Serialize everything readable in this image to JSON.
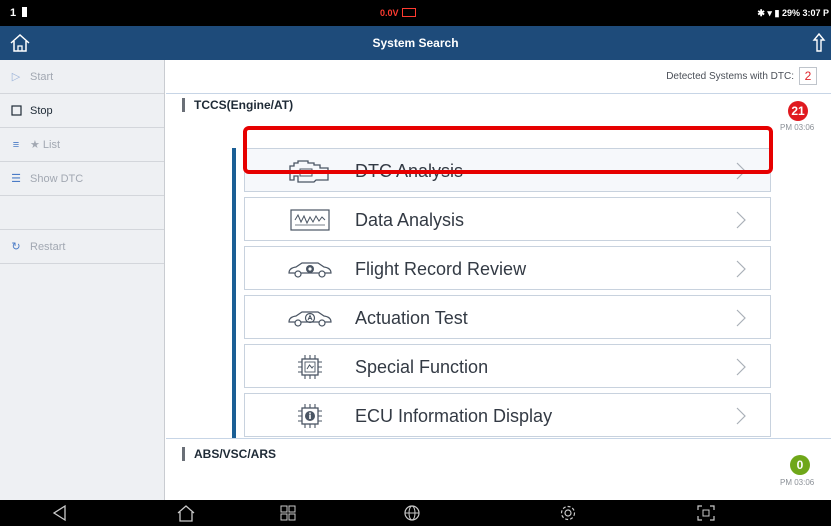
{
  "status_bar": {
    "left": "1",
    "voltage": "0.0V",
    "battery_pct": "29%",
    "clock": "3:07 P"
  },
  "title_bar": {
    "title": "System Search"
  },
  "sidebar": {
    "items": [
      {
        "label": "Start",
        "icon": "play-icon",
        "enabled": false
      },
      {
        "label": "Stop",
        "icon": "stop-square-icon",
        "enabled": true
      },
      {
        "label": "★ List",
        "icon": "list-icon",
        "enabled": false
      },
      {
        "label": "Show DTC",
        "icon": "dtc-list-icon",
        "enabled": false
      },
      {
        "label": "",
        "icon": "",
        "enabled": false
      },
      {
        "label": "Restart",
        "icon": "restart-icon",
        "enabled": false
      }
    ]
  },
  "main": {
    "detected_label": "Detected Systems with DTC:",
    "detected_count": "2",
    "systems": [
      {
        "name": "TCCS(Engine/AT)",
        "dtc_count": "21",
        "time": "PM 03:06",
        "badge_color": "#e0191f"
      },
      {
        "name": "ABS/VSC/ARS",
        "dtc_count": "0",
        "time": "PM 03:06",
        "badge_color": "#6fa719"
      }
    ],
    "menu": [
      {
        "label": "DTC Analysis",
        "icon": "engine-check-icon"
      },
      {
        "label": "Data Analysis",
        "icon": "waveform-icon"
      },
      {
        "label": "Flight Record Review",
        "icon": "car-record-icon"
      },
      {
        "label": "Actuation Test",
        "icon": "car-actuation-icon"
      },
      {
        "label": "Special Function",
        "icon": "chip-function-icon"
      },
      {
        "label": "ECU Information Display",
        "icon": "chip-info-icon"
      }
    ]
  },
  "nav_bar": {
    "icons": [
      "back-icon",
      "home-icon",
      "apps-grid-icon",
      "globe-icon",
      "settings-gear-icon",
      "screenshot-icon"
    ]
  },
  "colors": {
    "title_bar": "#1e4b7a",
    "highlight": "#e60000",
    "accent_bar": "#1b5f95"
  }
}
